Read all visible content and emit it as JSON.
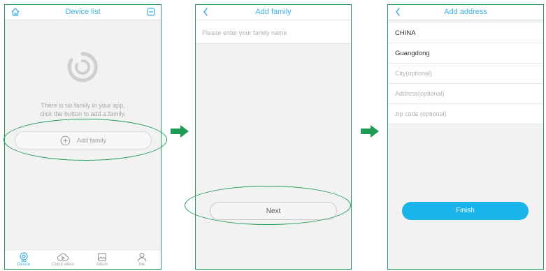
{
  "colors": {
    "accent": "#3fb0e4",
    "finish_button": "#19b5ea",
    "highlight": "#1f9a57"
  },
  "screen1": {
    "title": "Device list",
    "left_icon": "home-icon",
    "right_icon": "scan-icon",
    "empty_icon": "app-logo-icon",
    "empty_line1": "There is no family in your app,",
    "empty_line2": "click the button to add a family.",
    "add_family_label": "Add family",
    "tabs": [
      {
        "label": "Device",
        "icon": "camera-icon",
        "active": true
      },
      {
        "label": "Cloud video",
        "icon": "cloud-play-icon",
        "active": false
      },
      {
        "label": "Album",
        "icon": "image-icon",
        "active": false
      },
      {
        "label": "Me",
        "icon": "person-icon",
        "active": false
      }
    ]
  },
  "screen2": {
    "title": "Add family",
    "back_icon": "chevron-left-icon",
    "family_name_placeholder": "Please enter your family name",
    "next_label": "Next"
  },
  "screen3": {
    "title": "Add address",
    "back_icon": "chevron-left-icon",
    "fields": [
      {
        "value": "CHINA",
        "placeholder": false
      },
      {
        "value": "Guangdong",
        "placeholder": false
      },
      {
        "value": "City(optional)",
        "placeholder": true
      },
      {
        "value": "Address(optional)",
        "placeholder": true
      },
      {
        "value": "zip code (optional)",
        "placeholder": true
      }
    ],
    "finish_label": "Finish"
  }
}
